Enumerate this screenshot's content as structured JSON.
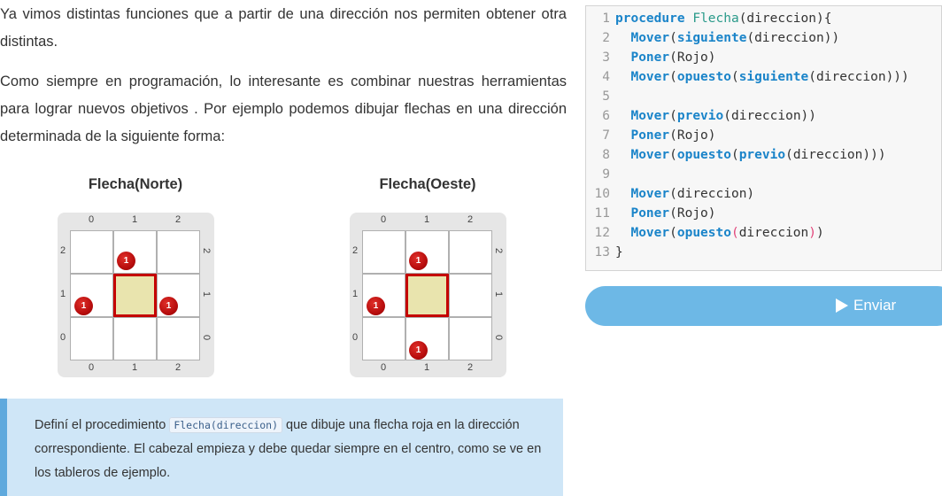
{
  "intro": {
    "p1": "Ya vimos distintas funciones que a partir de una dirección nos permiten obtener otra distintas.",
    "p2": "Como siempre en programación, lo interesante es combinar nuestras herramientas para lograr nuevos objetivos . Por ejemplo podemos dibujar flechas en una dirección determinada de la siguiente forma:"
  },
  "boards": [
    {
      "title": "Flecha(Norte)",
      "cols": [
        "0",
        "1",
        "2"
      ],
      "rows": [
        "2",
        "1",
        "0"
      ],
      "balls": [
        {
          "col": 1,
          "row": 2,
          "label": "1"
        },
        {
          "col": 0,
          "row": 1,
          "label": "1"
        },
        {
          "col": 2,
          "row": 1,
          "label": "1"
        }
      ],
      "head": {
        "col": 1,
        "row": 1
      }
    },
    {
      "title": "Flecha(Oeste)",
      "cols": [
        "0",
        "1",
        "2"
      ],
      "rows": [
        "2",
        "1",
        "0"
      ],
      "balls": [
        {
          "col": 1,
          "row": 2,
          "label": "1"
        },
        {
          "col": 0,
          "row": 1,
          "label": "1"
        },
        {
          "col": 1,
          "row": 0,
          "label": "1"
        }
      ],
      "head": {
        "col": 1,
        "row": 1
      }
    }
  ],
  "hint": {
    "before": "Definí el procedimiento ",
    "code": "Flecha(direccion)",
    "after": " que dibuje una flecha roja en la dirección correspondiente. El cabezal empieza y debe quedar siempre en el centro, como se ve en los tableros de ejemplo."
  },
  "editor": {
    "lines": [
      [
        [
          "kw",
          "procedure"
        ],
        [
          "ct",
          " "
        ],
        [
          "fn",
          "Flecha"
        ],
        [
          "ct",
          "(direccion){"
        ]
      ],
      [
        [
          "ct",
          "  "
        ],
        [
          "kw",
          "Mover"
        ],
        [
          "ct",
          "("
        ],
        [
          "kw",
          "siguiente"
        ],
        [
          "ct",
          "(direccion))"
        ]
      ],
      [
        [
          "ct",
          "  "
        ],
        [
          "kw",
          "Poner"
        ],
        [
          "ct",
          "(Rojo)"
        ]
      ],
      [
        [
          "ct",
          "  "
        ],
        [
          "kw",
          "Mover"
        ],
        [
          "ct",
          "("
        ],
        [
          "kw",
          "opuesto"
        ],
        [
          "ct",
          "("
        ],
        [
          "kw",
          "siguiente"
        ],
        [
          "ct",
          "(direccion)))"
        ]
      ],
      [],
      [
        [
          "ct",
          "  "
        ],
        [
          "kw",
          "Mover"
        ],
        [
          "ct",
          "("
        ],
        [
          "kw",
          "previo"
        ],
        [
          "ct",
          "(direccion))"
        ]
      ],
      [
        [
          "ct",
          "  "
        ],
        [
          "kw",
          "Poner"
        ],
        [
          "ct",
          "(Rojo)"
        ]
      ],
      [
        [
          "ct",
          "  "
        ],
        [
          "kw",
          "Mover"
        ],
        [
          "ct",
          "("
        ],
        [
          "kw",
          "opuesto"
        ],
        [
          "ct",
          "("
        ],
        [
          "kw",
          "previo"
        ],
        [
          "ct",
          "(direccion)))"
        ]
      ],
      [],
      [
        [
          "ct",
          "  "
        ],
        [
          "kw",
          "Mover"
        ],
        [
          "ct",
          "(direccion)"
        ]
      ],
      [
        [
          "ct",
          "  "
        ],
        [
          "kw",
          "Poner"
        ],
        [
          "ct",
          "(Rojo)"
        ]
      ],
      [
        [
          "ct",
          "  "
        ],
        [
          "kw",
          "Mover"
        ],
        [
          "ct",
          "("
        ],
        [
          "kw",
          "opuesto"
        ],
        [
          "red",
          "("
        ],
        [
          "ct",
          "direccion"
        ],
        [
          "red",
          ")"
        ],
        [
          "ct",
          ")"
        ]
      ],
      [
        [
          "ct",
          "}"
        ]
      ]
    ],
    "line_numbers": [
      "1",
      "2",
      "3",
      "4",
      "5",
      "6",
      "7",
      "8",
      "9",
      "10",
      "11",
      "12",
      "13"
    ]
  },
  "send_button": {
    "label": "Enviar",
    "icon": "play-icon"
  }
}
